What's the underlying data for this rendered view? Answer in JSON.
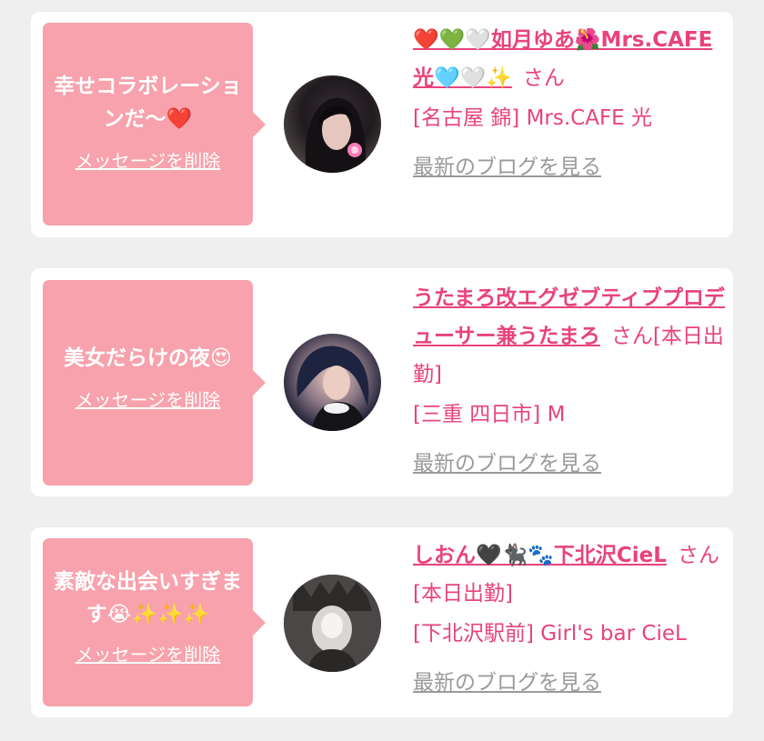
{
  "messages": [
    {
      "bubble_text": "幸せコラボレーションだ〜❤️",
      "delete_label": "メッセージを削除",
      "name": "❤️💚🤍如月ゆあ🌺Mrs.CAFE光🩵🤍✨",
      "san": "さん",
      "status": "",
      "store": "[名古屋 錦] Mrs.CAFE 光",
      "blog_label": "最新のブログを見る",
      "avatar_icon": "profile-photo"
    },
    {
      "bubble_text": "美女だらけの夜😍",
      "delete_label": "メッセージを削除",
      "name": "うたまろ改エグゼブティブプロデューサー兼うたまろ",
      "san": "さん",
      "status": "[本日出勤]",
      "store": "[三重 四日市] M",
      "blog_label": "最新のブログを見る",
      "avatar_icon": "profile-photo"
    },
    {
      "bubble_text": "素敵な出会いすぎます😭✨✨✨",
      "delete_label": "メッセージを削除",
      "name": "しおん🖤🐈‍⬛🐾下北沢CieL",
      "san": "さん",
      "status": "[本日出勤]",
      "store": "[下北沢駅前] Girl's bar CieL",
      "blog_label": "最新のブログを見る",
      "avatar_icon": "profile-photo"
    }
  ],
  "colors": {
    "bubble": "#f7a2ac",
    "accent": "#e8437c",
    "muted_link": "#9a9a9a",
    "background": "#efefef"
  }
}
